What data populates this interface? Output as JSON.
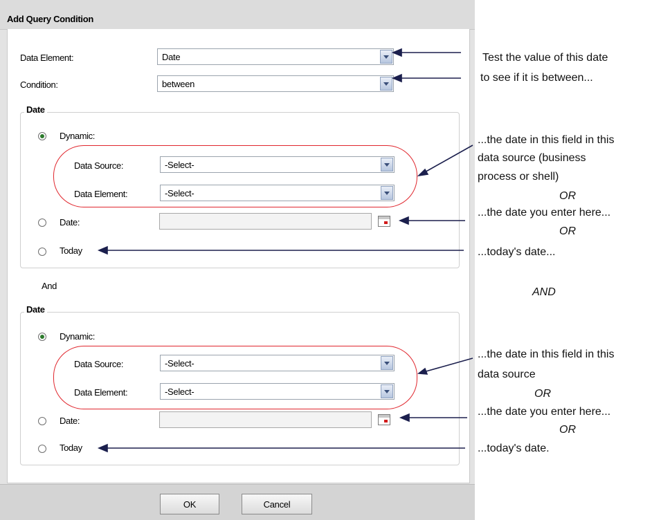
{
  "dialog": {
    "title": "Add Query Condition",
    "data_element_label": "Data Element:",
    "data_element_value": "Date",
    "condition_label": "Condition:",
    "condition_value": "between",
    "group1": {
      "legend": "Date",
      "dynamic_label": "Dynamic:",
      "data_source_label": "Data Source:",
      "data_source_value": "-Select-",
      "data_element_label": "Data Element:",
      "data_element_value": "-Select-",
      "date_label": "Date:",
      "date_value": "",
      "today_label": "Today",
      "selected": "dynamic"
    },
    "and_label": "And",
    "group2": {
      "legend": "Date",
      "dynamic_label": "Dynamic:",
      "data_source_label": "Data Source:",
      "data_source_value": "-Select-",
      "data_element_label": "Data Element:",
      "data_element_value": "-Select-",
      "date_label": "Date:",
      "date_value": "",
      "today_label": "Today",
      "selected": "dynamic"
    },
    "ok_label": "OK",
    "cancel_label": "Cancel"
  },
  "annotations": {
    "a1": "Test the value of this date",
    "a2": "to see if it is between...",
    "a3": "...the date in this field in this",
    "a4": "data source (business",
    "a5": "process or shell)",
    "a6": "OR",
    "a7": "...the date you enter here...",
    "a8": "OR",
    "a9": "...today's date...",
    "a10": "AND",
    "b1": "...the date in this field in this",
    "b2": "data source",
    "b3": "OR",
    "b4": "...the date you enter here...",
    "b5": "OR",
    "b6": "...today's date."
  },
  "colors": {
    "highlight": "#e0252c",
    "arrow": "#1b1f4d",
    "radio_selected": "#2c7a2c"
  }
}
